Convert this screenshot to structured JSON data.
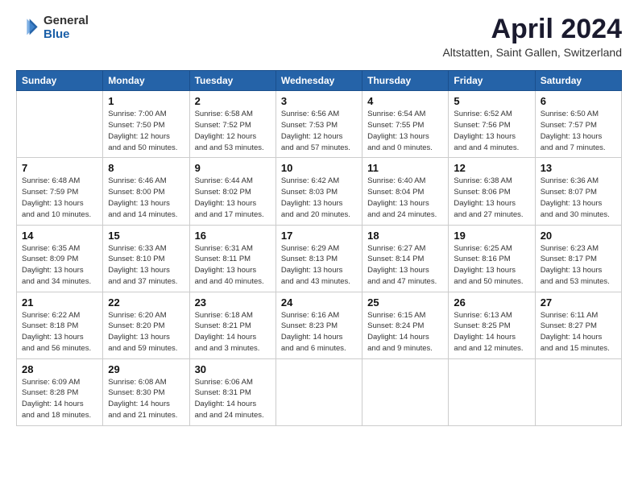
{
  "header": {
    "logo_general": "General",
    "logo_blue": "Blue",
    "title": "April 2024",
    "subtitle": "Altstatten, Saint Gallen, Switzerland"
  },
  "weekdays": [
    "Sunday",
    "Monday",
    "Tuesday",
    "Wednesday",
    "Thursday",
    "Friday",
    "Saturday"
  ],
  "weeks": [
    [
      {
        "day": "",
        "empty": true
      },
      {
        "day": "1",
        "sunrise": "Sunrise: 7:00 AM",
        "sunset": "Sunset: 7:50 PM",
        "daylight": "Daylight: 12 hours and 50 minutes."
      },
      {
        "day": "2",
        "sunrise": "Sunrise: 6:58 AM",
        "sunset": "Sunset: 7:52 PM",
        "daylight": "Daylight: 12 hours and 53 minutes."
      },
      {
        "day": "3",
        "sunrise": "Sunrise: 6:56 AM",
        "sunset": "Sunset: 7:53 PM",
        "daylight": "Daylight: 12 hours and 57 minutes."
      },
      {
        "day": "4",
        "sunrise": "Sunrise: 6:54 AM",
        "sunset": "Sunset: 7:55 PM",
        "daylight": "Daylight: 13 hours and 0 minutes."
      },
      {
        "day": "5",
        "sunrise": "Sunrise: 6:52 AM",
        "sunset": "Sunset: 7:56 PM",
        "daylight": "Daylight: 13 hours and 4 minutes."
      },
      {
        "day": "6",
        "sunrise": "Sunrise: 6:50 AM",
        "sunset": "Sunset: 7:57 PM",
        "daylight": "Daylight: 13 hours and 7 minutes."
      }
    ],
    [
      {
        "day": "7",
        "sunrise": "Sunrise: 6:48 AM",
        "sunset": "Sunset: 7:59 PM",
        "daylight": "Daylight: 13 hours and 10 minutes."
      },
      {
        "day": "8",
        "sunrise": "Sunrise: 6:46 AM",
        "sunset": "Sunset: 8:00 PM",
        "daylight": "Daylight: 13 hours and 14 minutes."
      },
      {
        "day": "9",
        "sunrise": "Sunrise: 6:44 AM",
        "sunset": "Sunset: 8:02 PM",
        "daylight": "Daylight: 13 hours and 17 minutes."
      },
      {
        "day": "10",
        "sunrise": "Sunrise: 6:42 AM",
        "sunset": "Sunset: 8:03 PM",
        "daylight": "Daylight: 13 hours and 20 minutes."
      },
      {
        "day": "11",
        "sunrise": "Sunrise: 6:40 AM",
        "sunset": "Sunset: 8:04 PM",
        "daylight": "Daylight: 13 hours and 24 minutes."
      },
      {
        "day": "12",
        "sunrise": "Sunrise: 6:38 AM",
        "sunset": "Sunset: 8:06 PM",
        "daylight": "Daylight: 13 hours and 27 minutes."
      },
      {
        "day": "13",
        "sunrise": "Sunrise: 6:36 AM",
        "sunset": "Sunset: 8:07 PM",
        "daylight": "Daylight: 13 hours and 30 minutes."
      }
    ],
    [
      {
        "day": "14",
        "sunrise": "Sunrise: 6:35 AM",
        "sunset": "Sunset: 8:09 PM",
        "daylight": "Daylight: 13 hours and 34 minutes."
      },
      {
        "day": "15",
        "sunrise": "Sunrise: 6:33 AM",
        "sunset": "Sunset: 8:10 PM",
        "daylight": "Daylight: 13 hours and 37 minutes."
      },
      {
        "day": "16",
        "sunrise": "Sunrise: 6:31 AM",
        "sunset": "Sunset: 8:11 PM",
        "daylight": "Daylight: 13 hours and 40 minutes."
      },
      {
        "day": "17",
        "sunrise": "Sunrise: 6:29 AM",
        "sunset": "Sunset: 8:13 PM",
        "daylight": "Daylight: 13 hours and 43 minutes."
      },
      {
        "day": "18",
        "sunrise": "Sunrise: 6:27 AM",
        "sunset": "Sunset: 8:14 PM",
        "daylight": "Daylight: 13 hours and 47 minutes."
      },
      {
        "day": "19",
        "sunrise": "Sunrise: 6:25 AM",
        "sunset": "Sunset: 8:16 PM",
        "daylight": "Daylight: 13 hours and 50 minutes."
      },
      {
        "day": "20",
        "sunrise": "Sunrise: 6:23 AM",
        "sunset": "Sunset: 8:17 PM",
        "daylight": "Daylight: 13 hours and 53 minutes."
      }
    ],
    [
      {
        "day": "21",
        "sunrise": "Sunrise: 6:22 AM",
        "sunset": "Sunset: 8:18 PM",
        "daylight": "Daylight: 13 hours and 56 minutes."
      },
      {
        "day": "22",
        "sunrise": "Sunrise: 6:20 AM",
        "sunset": "Sunset: 8:20 PM",
        "daylight": "Daylight: 13 hours and 59 minutes."
      },
      {
        "day": "23",
        "sunrise": "Sunrise: 6:18 AM",
        "sunset": "Sunset: 8:21 PM",
        "daylight": "Daylight: 14 hours and 3 minutes."
      },
      {
        "day": "24",
        "sunrise": "Sunrise: 6:16 AM",
        "sunset": "Sunset: 8:23 PM",
        "daylight": "Daylight: 14 hours and 6 minutes."
      },
      {
        "day": "25",
        "sunrise": "Sunrise: 6:15 AM",
        "sunset": "Sunset: 8:24 PM",
        "daylight": "Daylight: 14 hours and 9 minutes."
      },
      {
        "day": "26",
        "sunrise": "Sunrise: 6:13 AM",
        "sunset": "Sunset: 8:25 PM",
        "daylight": "Daylight: 14 hours and 12 minutes."
      },
      {
        "day": "27",
        "sunrise": "Sunrise: 6:11 AM",
        "sunset": "Sunset: 8:27 PM",
        "daylight": "Daylight: 14 hours and 15 minutes."
      }
    ],
    [
      {
        "day": "28",
        "sunrise": "Sunrise: 6:09 AM",
        "sunset": "Sunset: 8:28 PM",
        "daylight": "Daylight: 14 hours and 18 minutes."
      },
      {
        "day": "29",
        "sunrise": "Sunrise: 6:08 AM",
        "sunset": "Sunset: 8:30 PM",
        "daylight": "Daylight: 14 hours and 21 minutes."
      },
      {
        "day": "30",
        "sunrise": "Sunrise: 6:06 AM",
        "sunset": "Sunset: 8:31 PM",
        "daylight": "Daylight: 14 hours and 24 minutes."
      },
      {
        "day": "",
        "empty": true
      },
      {
        "day": "",
        "empty": true
      },
      {
        "day": "",
        "empty": true
      },
      {
        "day": "",
        "empty": true
      }
    ]
  ]
}
